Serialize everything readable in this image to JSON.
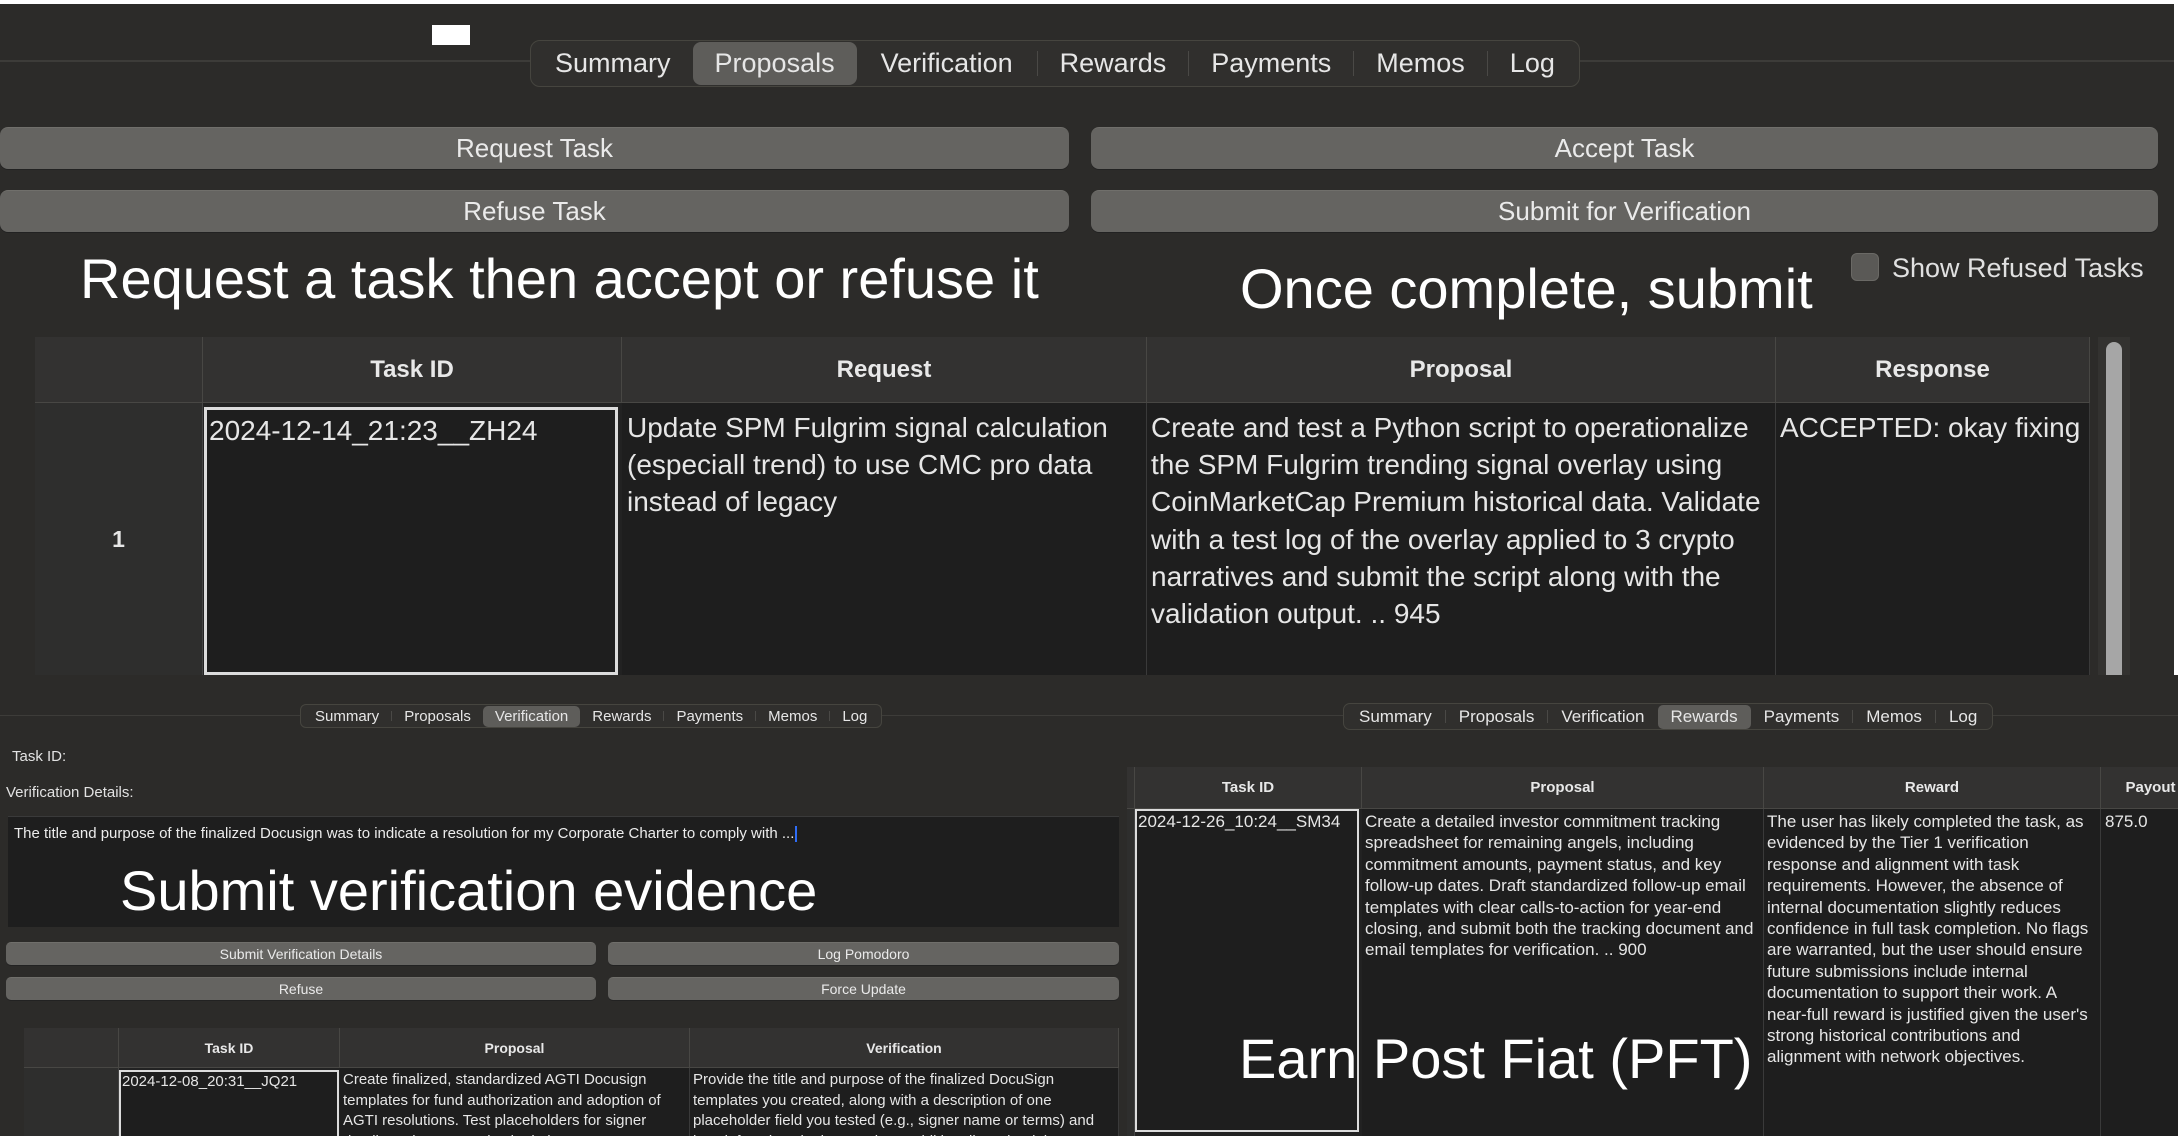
{
  "tabs": [
    "Summary",
    "Proposals",
    "Verification",
    "Rewards",
    "Payments",
    "Memos",
    "Log"
  ],
  "proposals_panel": {
    "active_tab": "Proposals",
    "buttons": {
      "request_task": "Request Task",
      "accept_task": "Accept Task",
      "refuse_task": "Refuse Task",
      "submit_for_verification": "Submit for Verification"
    },
    "annotation_left": "Request a task then accept or refuse it",
    "annotation_right": "Once complete, submit",
    "show_refused_label": "Show Refused Tasks",
    "show_refused_checked": false,
    "table": {
      "headers": [
        "Task ID",
        "Request",
        "Proposal",
        "Response"
      ],
      "rows": [
        {
          "row_num": "1",
          "task_id": "2024-12-14_21:23__ZH24",
          "request": "Update SPM Fulgrim signal calculation (especiall trend) to use CMC pro data instead of legacy",
          "proposal": "Create and test a Python script to operationalize the SPM Fulgrim trending signal overlay using CoinMarketCap Premium historical data. Validate with a test log of the overlay applied to 3 crypto narratives and submit the script along with the validation output. .. 945",
          "response": "ACCEPTED: okay fixing"
        }
      ]
    }
  },
  "verification_panel": {
    "active_tab": "Verification",
    "task_id_label": "Task ID:",
    "task_id_value": "",
    "details_label": "Verification Details:",
    "details_value": "The title and purpose of the finalized Docusign was to indicate a resolution for my Corporate Charter to comply with ...",
    "annotation": "Submit verification evidence",
    "buttons": {
      "submit_details": "Submit Verification Details",
      "log_pomodoro": "Log Pomodoro",
      "refuse": "Refuse",
      "force_update": "Force Update"
    },
    "table": {
      "headers": [
        "Task ID",
        "Proposal",
        "Verification"
      ],
      "rows": [
        {
          "task_id": "2024-12-08_20:31__JQ21",
          "proposal": "Create finalized, standardized AGTI Docusign templates for fund authorization and adoption of AGTI resolutions. Test placeholders for signer details and terms, and submit the",
          "verification": "Provide the title and purpose of the finalized DocuSign templates you created, along with a description of one placeholder field you tested (e.g., signer name or terms) and how it functions in the template. Additionally, upload the"
        }
      ]
    }
  },
  "rewards_panel": {
    "active_tab": "Rewards",
    "annotation": "Earn Post Fiat (PFT)",
    "table": {
      "headers": [
        "Task ID",
        "Proposal",
        "Reward",
        "Payout"
      ],
      "rows": [
        {
          "task_id": "2024-12-26_10:24__SM34",
          "proposal": "Create a detailed investor commitment tracking spreadsheet for remaining angels, including commitment amounts, payment status, and key follow-up dates. Draft standardized follow-up email templates with clear calls-to-action for year-end closing, and submit both the tracking document and email templates for verification. .. 900",
          "reward": "The user has likely completed the task, as evidenced by the Tier 1 verification response and alignment with task requirements. However, the absence of internal documentation slightly reduces confidence in full task completion. No flags are warranted, but the user should ensure future submissions include internal documentation to support their work. A near-full reward is justified given the user's strong historical contributions and alignment with network objectives.",
          "payout": "875.0"
        }
      ]
    }
  },
  "colors": {
    "window_bg": "#2c2b29",
    "button_bg": "#656461",
    "active_tab_bg": "#5e5d5a",
    "cell_bg": "#1e1e1e",
    "header_bg": "#333231",
    "caret": "#2e6cf5"
  }
}
